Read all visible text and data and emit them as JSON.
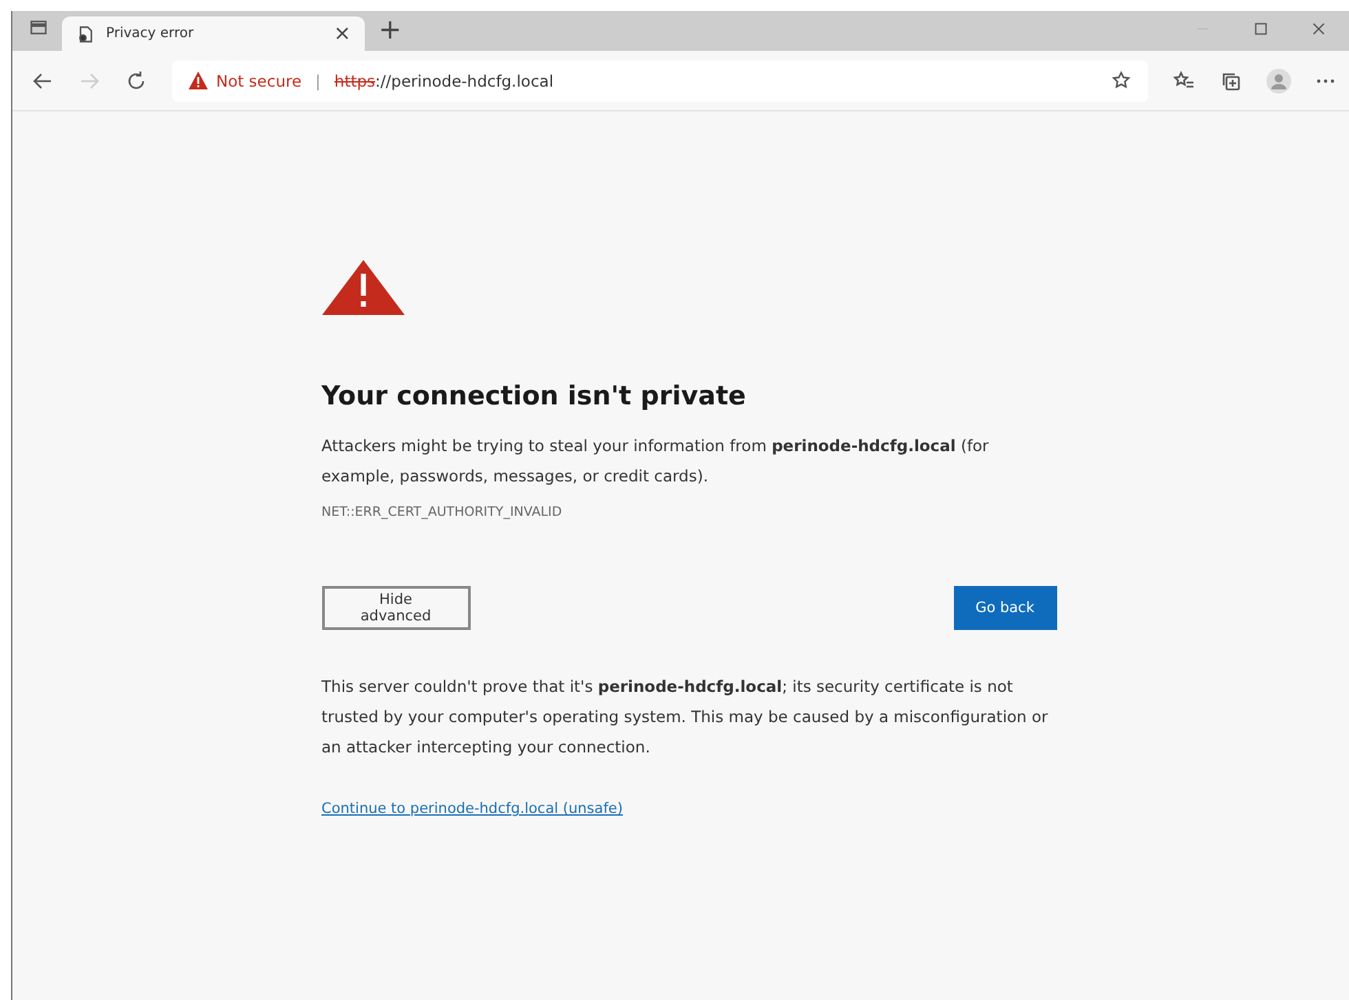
{
  "tab": {
    "title": "Privacy error",
    "close": "×",
    "new_tab": "+"
  },
  "address_bar": {
    "security_label": "Not secure",
    "separator": "|",
    "scheme": "https",
    "rest": "://perinode-hdcfg.local"
  },
  "page": {
    "heading": "Your connection isn't private",
    "message": "Attackers might be trying to steal your information from **perinode-hdcfg.local** (for example, passwords, messages, or credit cards).",
    "error_code": "NET::ERR_CERT_AUTHORITY_INVALID",
    "buttons": [
      {
        "label": "Hide advanced",
        "kind": "secondary"
      },
      {
        "label": "Go back",
        "kind": "primary"
      }
    ],
    "details": "This server couldn't prove that it's **perinode-hdcfg.local**; its security certificate is not trusted by your computer's operating system. This may be caused by a misconfiguration or an attacker intercepting your connection.",
    "continue_link": "Continue to perinode-hdcfg.local (unsafe)"
  }
}
